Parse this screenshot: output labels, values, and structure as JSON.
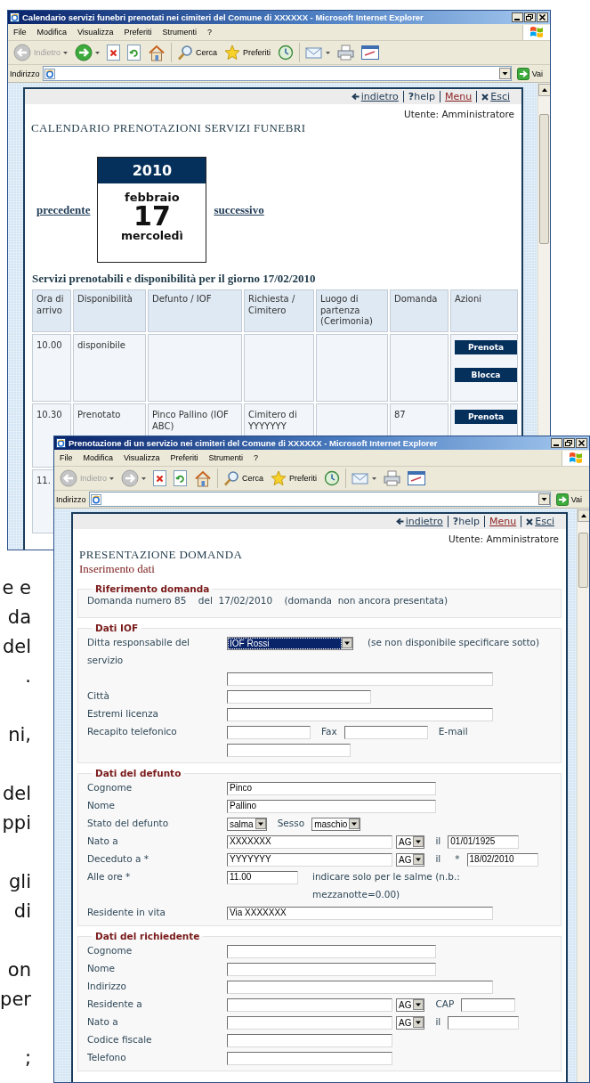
{
  "background_text": [
    [
      "e e",
      "da",
      "del",
      "."
    ],
    [
      "ni,"
    ],
    [
      "del",
      "ppi"
    ],
    [
      "gli",
      "di"
    ],
    [
      "on",
      "per"
    ],
    [
      ";"
    ]
  ],
  "calendar_window": {
    "title": "Calendario servizi funebri prenotati nei cimiteri del Comune di XXXXXX - Microsoft Internet Explorer",
    "menu": [
      "File",
      "Modifica",
      "Visualizza",
      "Preferiti",
      "Strumenti",
      "?"
    ],
    "toolbar": [
      {
        "kind": "back",
        "label": "Indietro",
        "disabled": true
      },
      {
        "kind": "forward",
        "disabled": false
      },
      {
        "kind": "stop"
      },
      {
        "kind": "refresh"
      },
      {
        "kind": "home"
      },
      {
        "kind": "search",
        "label": "Cerca"
      },
      {
        "kind": "favorites",
        "label": "Preferiti"
      },
      {
        "kind": "history"
      },
      {
        "kind": "mail"
      },
      {
        "kind": "print"
      },
      {
        "kind": "edit"
      }
    ],
    "address_label": "Indirizzo",
    "go_label": "Vai",
    "nav": [
      {
        "kind": "back",
        "label": "indietro"
      },
      {
        "kind": "help",
        "label": "**?**help"
      },
      {
        "kind": "menu",
        "label": "Menu"
      },
      {
        "kind": "exit",
        "label": "Esci"
      }
    ],
    "user": "Utente: Amministratore",
    "heading": "CALENDARIO PRENOTAZIONI SERVIZI FUNEBRI",
    "prev": "precedente",
    "next": "successivo",
    "date": {
      "year": "2010",
      "month": "febbraio",
      "day": "17",
      "weekday": "mercoledì"
    },
    "table_caption": "Servizi prenotabili e disponibilità per il giorno 17/02/2010",
    "table": {
      "columns": [
        "Ora di arrivo",
        "Disponibilità",
        "Defunto / IOF",
        "Richiesta / Cimitero",
        "Luogo di partenza (Cerimonia)",
        "Domanda",
        "Azioni"
      ],
      "rows": [
        {
          "time": "10.00",
          "availability": "disponibile",
          "actions": [
            "Prenota",
            "Blocca"
          ]
        },
        {
          "time": "10.30",
          "availability": "Prenotato",
          "deceased": "Pinco Pallino (IOF ABC)",
          "cemetery": "Cimitero di YYYYYYY",
          "application": "87",
          "actions": [
            "Prenota"
          ]
        },
        {
          "time": "11."
        }
      ]
    }
  },
  "form_window": {
    "title": "Prenotazione di un servizio nei cimiteri del Comune di XXXXXX - Microsoft Internet Explorer",
    "menu": [
      "File",
      "Modifica",
      "Visualizza",
      "Preferiti",
      "Strumenti",
      "?"
    ],
    "toolbar": [
      {
        "kind": "back",
        "label": "Indietro",
        "disabled": true
      },
      {
        "kind": "forward",
        "disabled": true
      },
      {
        "kind": "stop"
      },
      {
        "kind": "refresh"
      },
      {
        "kind": "home"
      },
      {
        "kind": "search",
        "label": "Cerca"
      },
      {
        "kind": "favorites",
        "label": "Preferiti"
      },
      {
        "kind": "history"
      },
      {
        "kind": "mail"
      },
      {
        "kind": "print"
      },
      {
        "kind": "edit"
      }
    ],
    "address_label": "Indirizzo",
    "go_label": "Vai",
    "nav": [
      {
        "kind": "back",
        "label": "indietro"
      },
      {
        "kind": "help",
        "label": "**?**help"
      },
      {
        "kind": "menu",
        "label": "Menu"
      },
      {
        "kind": "exit",
        "label": "Esci"
      }
    ],
    "user": "Utente: Amministratore",
    "heading": "PRESENTAZIONE DOMANDA",
    "subheading": "Inserimento dati",
    "sections": [
      {
        "legend": "Riferimento domanda",
        "text": "Domanda numero 85    del  17/02/2010    (domanda  non ancora presentata)"
      },
      {
        "legend": "Dati IOF",
        "rows": [
          {
            "label": "Ditta responsabile del servizio",
            "controls": [
              {
                "kind": "company",
                "value": "IOF Rossi",
                "focused": true
              },
              {
                "kind": "note",
                "text": "(se non disponibile specificare sotto)"
              }
            ]
          },
          {
            "controls": [
              {
                "kind": "line"
              }
            ]
          },
          {
            "label": "Città",
            "controls": [
              {
                "kind": "city"
              }
            ]
          },
          {
            "label": "Estremi licenza",
            "controls": [
              {
                "kind": "line"
              }
            ]
          },
          {
            "label": "Recapito telefonico",
            "controls": [
              {
                "kind": "phone"
              },
              {
                "kind": "label",
                "text": "Fax"
              },
              {
                "kind": "phone"
              },
              {
                "kind": "label",
                "text": "E-mail"
              }
            ]
          },
          {
            "controls": [
              {
                "kind": "contact"
              }
            ]
          }
        ]
      },
      {
        "legend": "Dati del defunto",
        "rows": [
          {
            "label": "Cognome",
            "controls": [
              {
                "kind": "name",
                "value": "Pinco"
              }
            ]
          },
          {
            "label": "Nome",
            "controls": [
              {
                "kind": "name",
                "value": "Pallino"
              }
            ]
          },
          {
            "label": "Stato del defunto",
            "controls": [
              {
                "kind": "select",
                "value": "salma"
              },
              {
                "kind": "label",
                "text": "Sesso"
              },
              {
                "kind": "select",
                "value": "maschio"
              }
            ]
          },
          {
            "label": "Nato a",
            "controls": [
              {
                "kind": "place",
                "value": "XXXXXXX"
              },
              {
                "kind": "select",
                "value": "AG"
              },
              {
                "kind": "label",
                "text": "il"
              },
              {
                "kind": "date",
                "value": "01/01/1925"
              }
            ]
          },
          {
            "label": "Deceduto a  *",
            "controls": [
              {
                "kind": "place",
                "value": "YYYYYYY"
              },
              {
                "kind": "select",
                "value": "AG"
              },
              {
                "kind": "label",
                "text": "il"
              },
              {
                "kind": "label",
                "text": "*"
              },
              {
                "kind": "date",
                "value": "18/02/2010"
              }
            ]
          },
          {
            "label": "Alle ore  *",
            "controls": [
              {
                "kind": "time",
                "value": "11.00"
              },
              {
                "kind": "note",
                "text": "indicare solo per le salme (n.b.: mezzanotte=0.00)"
              }
            ]
          },
          {
            "label": "Residente in vita",
            "controls": [
              {
                "kind": "line",
                "value": "Via XXXXXXX"
              }
            ]
          }
        ]
      },
      {
        "legend": "Dati del richiedente",
        "rows": [
          {
            "label": "Cognome",
            "controls": [
              {
                "kind": "name"
              }
            ]
          },
          {
            "label": "Nome",
            "controls": [
              {
                "kind": "name"
              }
            ]
          },
          {
            "label": "Indirizzo",
            "controls": [
              {
                "kind": "line"
              }
            ]
          },
          {
            "label": "Residente a",
            "controls": [
              {
                "kind": "place"
              },
              {
                "kind": "select",
                "value": "AG"
              },
              {
                "kind": "label",
                "text": "CAP"
              },
              {
                "kind": "postcode"
              }
            ]
          },
          {
            "label": "Nato a",
            "controls": [
              {
                "kind": "place"
              },
              {
                "kind": "select",
                "value": "AG"
              },
              {
                "kind": "label",
                "text": "il"
              },
              {
                "kind": "date"
              }
            ]
          },
          {
            "label": "Codice fiscale",
            "controls": [
              {
                "kind": "place"
              }
            ]
          },
          {
            "label": "Telefono",
            "controls": [
              {
                "kind": "place"
              }
            ]
          }
        ]
      }
    ]
  }
}
